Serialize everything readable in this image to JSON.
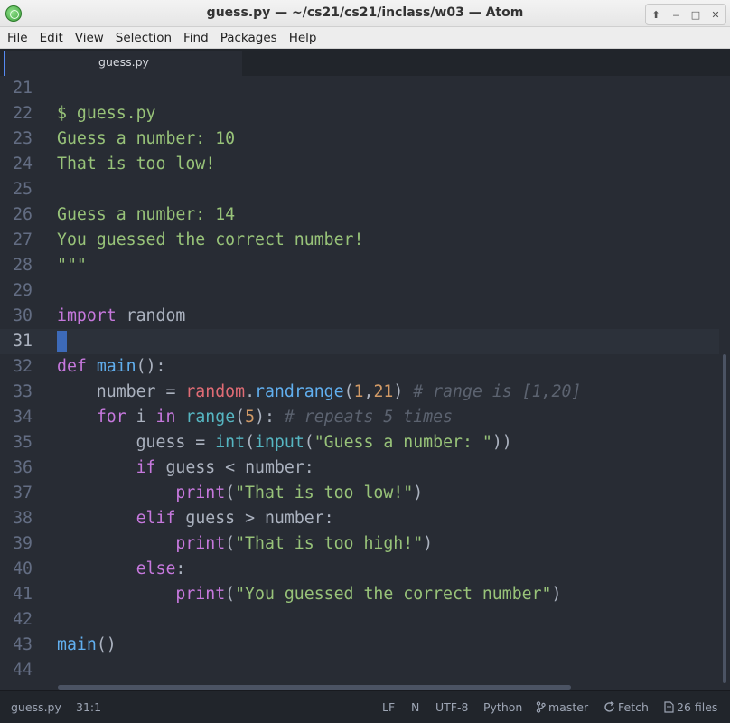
{
  "window": {
    "title": "guess.py — ~/cs21/cs21/inclass/w03 — Atom",
    "buttons": [
      "⬆",
      "‒",
      "□",
      "✕"
    ]
  },
  "menubar": {
    "items": [
      "File",
      "Edit",
      "View",
      "Selection",
      "Find",
      "Packages",
      "Help"
    ]
  },
  "tabs": [
    {
      "label": "guess.py",
      "active": true
    }
  ],
  "editor": {
    "cursor_line": 31,
    "lines": [
      {
        "n": "21",
        "tokens": []
      },
      {
        "n": "22",
        "tokens": [
          {
            "t": "$ guess.py",
            "c": "t-str"
          }
        ]
      },
      {
        "n": "23",
        "tokens": [
          {
            "t": "Guess a number: 10",
            "c": "t-str"
          }
        ]
      },
      {
        "n": "24",
        "tokens": [
          {
            "t": "That is too low!",
            "c": "t-str"
          }
        ]
      },
      {
        "n": "25",
        "tokens": []
      },
      {
        "n": "26",
        "tokens": [
          {
            "t": "Guess a number: 14",
            "c": "t-str"
          }
        ]
      },
      {
        "n": "27",
        "tokens": [
          {
            "t": "You guessed the correct number!",
            "c": "t-str"
          }
        ]
      },
      {
        "n": "28",
        "tokens": [
          {
            "t": "\"\"\"",
            "c": "t-str"
          }
        ]
      },
      {
        "n": "29",
        "tokens": []
      },
      {
        "n": "30",
        "tokens": [
          {
            "t": "import",
            "c": "t-kw"
          },
          {
            "t": " random",
            "c": "t-pl"
          }
        ]
      },
      {
        "n": "31",
        "tokens": []
      },
      {
        "n": "32",
        "tokens": [
          {
            "t": "def",
            "c": "t-kw"
          },
          {
            "t": " ",
            "c": "t-pl"
          },
          {
            "t": "main",
            "c": "t-fn"
          },
          {
            "t": "():",
            "c": "t-pl"
          }
        ]
      },
      {
        "n": "33",
        "tokens": [
          {
            "t": "    number = ",
            "c": "t-pl"
          },
          {
            "t": "random",
            "c": "t-var"
          },
          {
            "t": ".",
            "c": "t-pl"
          },
          {
            "t": "randrange",
            "c": "t-fn"
          },
          {
            "t": "(",
            "c": "t-pl"
          },
          {
            "t": "1",
            "c": "t-num"
          },
          {
            "t": ",",
            "c": "t-pl"
          },
          {
            "t": "21",
            "c": "t-num"
          },
          {
            "t": ") ",
            "c": "t-pl"
          },
          {
            "t": "# range is [1,20]",
            "c": "t-cm"
          }
        ]
      },
      {
        "n": "34",
        "tokens": [
          {
            "t": "    ",
            "c": "t-pl"
          },
          {
            "t": "for",
            "c": "t-kw"
          },
          {
            "t": " i ",
            "c": "t-pl"
          },
          {
            "t": "in",
            "c": "t-kw"
          },
          {
            "t": " ",
            "c": "t-pl"
          },
          {
            "t": "range",
            "c": "t-builtin"
          },
          {
            "t": "(",
            "c": "t-pl"
          },
          {
            "t": "5",
            "c": "t-num"
          },
          {
            "t": "): ",
            "c": "t-pl"
          },
          {
            "t": "# repeats 5 times",
            "c": "t-cm"
          }
        ]
      },
      {
        "n": "35",
        "tokens": [
          {
            "t": "        guess = ",
            "c": "t-pl"
          },
          {
            "t": "int",
            "c": "t-builtin"
          },
          {
            "t": "(",
            "c": "t-pl"
          },
          {
            "t": "input",
            "c": "t-builtin"
          },
          {
            "t": "(",
            "c": "t-pl"
          },
          {
            "t": "\"Guess a number: \"",
            "c": "t-str"
          },
          {
            "t": "))",
            "c": "t-pl"
          }
        ]
      },
      {
        "n": "36",
        "tokens": [
          {
            "t": "        ",
            "c": "t-pl"
          },
          {
            "t": "if",
            "c": "t-kw"
          },
          {
            "t": " guess < number:",
            "c": "t-pl"
          }
        ]
      },
      {
        "n": "37",
        "tokens": [
          {
            "t": "            ",
            "c": "t-pl"
          },
          {
            "t": "print",
            "c": "t-kw"
          },
          {
            "t": "(",
            "c": "t-pl"
          },
          {
            "t": "\"That is too low!\"",
            "c": "t-str"
          },
          {
            "t": ")",
            "c": "t-pl"
          }
        ]
      },
      {
        "n": "38",
        "tokens": [
          {
            "t": "        ",
            "c": "t-pl"
          },
          {
            "t": "elif",
            "c": "t-kw"
          },
          {
            "t": " guess > number:",
            "c": "t-pl"
          }
        ]
      },
      {
        "n": "39",
        "tokens": [
          {
            "t": "            ",
            "c": "t-pl"
          },
          {
            "t": "print",
            "c": "t-kw"
          },
          {
            "t": "(",
            "c": "t-pl"
          },
          {
            "t": "\"That is too high!\"",
            "c": "t-str"
          },
          {
            "t": ")",
            "c": "t-pl"
          }
        ]
      },
      {
        "n": "40",
        "tokens": [
          {
            "t": "        ",
            "c": "t-pl"
          },
          {
            "t": "else",
            "c": "t-kw"
          },
          {
            "t": ":",
            "c": "t-pl"
          }
        ]
      },
      {
        "n": "41",
        "tokens": [
          {
            "t": "            ",
            "c": "t-pl"
          },
          {
            "t": "print",
            "c": "t-kw"
          },
          {
            "t": "(",
            "c": "t-pl"
          },
          {
            "t": "\"You guessed the correct number\"",
            "c": "t-str"
          },
          {
            "t": ")",
            "c": "t-pl"
          }
        ]
      },
      {
        "n": "42",
        "tokens": []
      },
      {
        "n": "43",
        "tokens": [
          {
            "t": "main",
            "c": "t-fn"
          },
          {
            "t": "()",
            "c": "t-pl"
          }
        ]
      },
      {
        "n": "44",
        "tokens": []
      }
    ]
  },
  "statusbar": {
    "file": "guess.py",
    "position": "31:1",
    "line_ending": "LF",
    "n_indicator": "N",
    "encoding": "UTF-8",
    "grammar": "Python",
    "branch": "master",
    "fetch": "Fetch",
    "files": "26 files"
  },
  "colors": {
    "editor_bg": "#282c34",
    "string": "#98c379",
    "keyword": "#c678dd",
    "function": "#61afef",
    "comment": "#5c6370",
    "number": "#d19a66"
  }
}
